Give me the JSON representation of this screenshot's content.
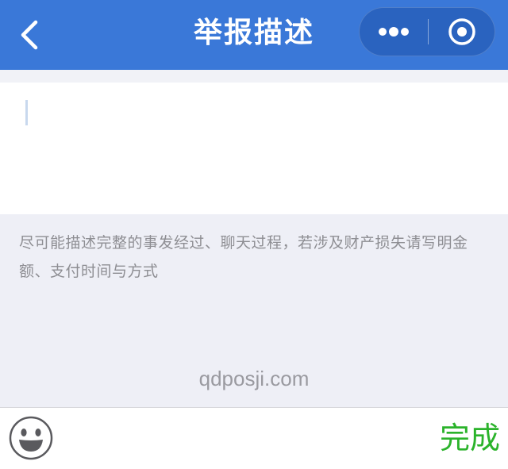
{
  "nav": {
    "title": "举报描述",
    "back_icon": "chevron-left-icon",
    "more_icon": "more-dots-icon",
    "close_icon": "target-circle-icon"
  },
  "form": {
    "placeholder_hint": "尽可能描述完整的事发经过、聊天过程，若涉及财产损失请写明金额、支付时间与方式"
  },
  "watermark": "qdposji.com",
  "toolbar": {
    "emoji_icon": "smiley-face-icon",
    "done_label": "完成"
  },
  "colors": {
    "nav_bar": "#3a78d8",
    "capsule": "#2a63bf",
    "done": "#2bb32b",
    "background": "#eeeff6"
  }
}
